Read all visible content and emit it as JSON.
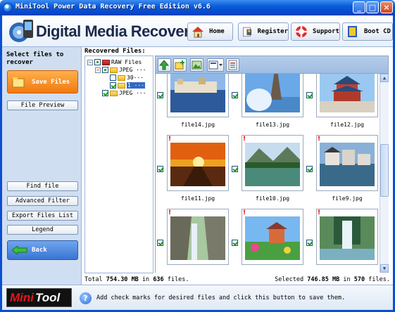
{
  "window": {
    "title": "MiniTool Power Data Recovery Free Edition v6.6"
  },
  "header": {
    "brand": "Digital Media Recovery",
    "buttons": {
      "home": "Home",
      "register": "Register",
      "support": "Support",
      "boot": "Boot CD"
    }
  },
  "sidebar": {
    "heading": "Select files to recover",
    "save": "Save Files",
    "preview": "File Preview",
    "find": "Find file",
    "advanced_filter": "Advanced Filter",
    "export": "Export Files List",
    "legend": "Legend",
    "back": "Back"
  },
  "main": {
    "heading": "Recovered Files:",
    "tree": [
      {
        "label": "RAW Files",
        "level": 0
      },
      {
        "label": "JPEG ···",
        "level": 1
      },
      {
        "label": "30···",
        "level": 2
      },
      {
        "label": "1 ···",
        "level": 2
      },
      {
        "label": "JPEG ···",
        "level": 1
      }
    ],
    "files": [
      {
        "name": "file14.jpg",
        "scene": "harbor"
      },
      {
        "name": "file13.jpg",
        "scene": "eiffel"
      },
      {
        "name": "file12.jpg",
        "scene": "temple"
      },
      {
        "name": "file11.jpg",
        "scene": "sunset"
      },
      {
        "name": "file10.jpg",
        "scene": "lake"
      },
      {
        "name": "file9.jpg",
        "scene": "village"
      },
      {
        "name": "",
        "scene": "cliff"
      },
      {
        "name": "",
        "scene": "garden"
      },
      {
        "name": "",
        "scene": "waterfall"
      }
    ],
    "status_left": {
      "prefix": "Total",
      "size": "754.30",
      "unit": "MB",
      "mid": "in",
      "count": "636",
      "suffix": "files."
    },
    "status_right": {
      "prefix": "Selected",
      "size": "746.85",
      "unit": "MB",
      "mid": "in",
      "count": "570",
      "suffix": "files."
    }
  },
  "footer": {
    "logo_mini": "Mini",
    "logo_tool": "Tool",
    "hint": "Add check marks for desired files and click this button to save them."
  },
  "colors": {
    "title_bar": "#0a5cdb",
    "sidebar_bg": "#cfdef1",
    "save_orange": "#f07a10",
    "back_blue": "#3a74d4"
  }
}
